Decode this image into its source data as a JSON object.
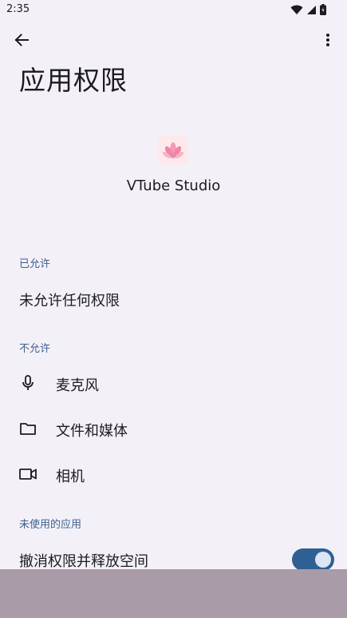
{
  "status": {
    "time": "2:35"
  },
  "page": {
    "title": "应用权限"
  },
  "app": {
    "name": "VTube Studio",
    "icon": "vtube-studio-app-icon"
  },
  "sections": {
    "allowed": {
      "header": "已允许",
      "empty_text": "未允许任何权限"
    },
    "denied": {
      "header": "不允许",
      "items": [
        {
          "label": "麦克风",
          "icon": "microphone-icon"
        },
        {
          "label": "文件和媒体",
          "icon": "folder-icon"
        },
        {
          "label": "相机",
          "icon": "camera-icon"
        }
      ]
    },
    "unused": {
      "header": "未使用的应用",
      "toggle_label": "撤消权限并释放空间",
      "toggle_on": true
    }
  },
  "colors": {
    "accent": "#2f5f93",
    "section_header": "#3f5f91",
    "background": "#f3f1f7"
  }
}
